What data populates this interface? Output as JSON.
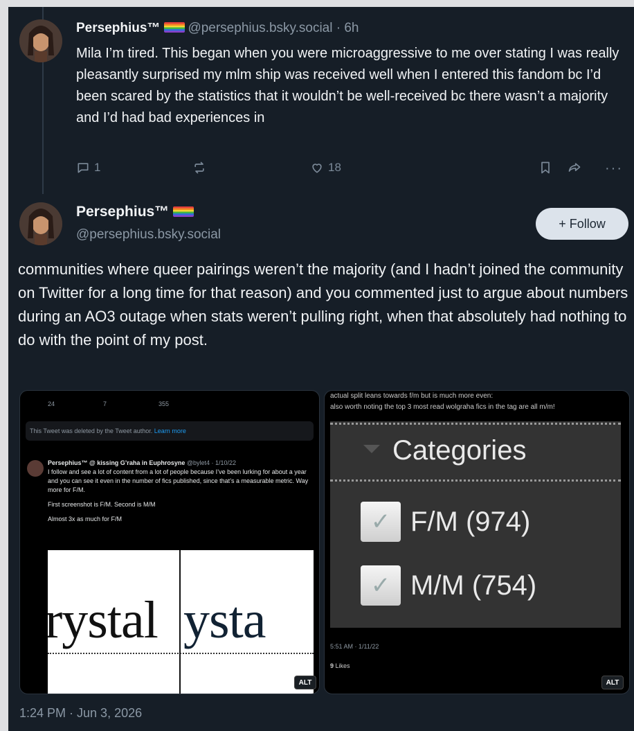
{
  "post1": {
    "name": "Persephius™",
    "handle": "@persephius.bsky.social",
    "time": "· 6h",
    "body": "Mila I’m tired. This began when you were microaggressive to me over stating I was really pleasantly surprised my mlm ship was received well when I entered this fandom bc I’d been scared by the statistics that it wouldn’t be well-received bc there wasn’t a majority and I’d had bad experiences in",
    "replies": "1",
    "likes": "18"
  },
  "post2": {
    "name": "Persephius™",
    "handle": "@persephius.bsky.social",
    "follow_label": "+ Follow",
    "body": "communities where queer pairings weren’t the majority (and I hadn’t joined the community on Twitter for a long time for that reason) and you commented just to argue about numbers during an AO3 outage when stats weren’t pulling right, when that absolutely had nothing to do with the point of my post.",
    "timestamp": "1:24 PM · Jun 3, 2026"
  },
  "image1": {
    "counts": [
      "24",
      "7",
      "355"
    ],
    "deleted_text": "This Tweet was deleted by the Tweet author.",
    "learn_more": "Learn more",
    "tweet_author": "Persephius™ @ kissing G’raha in Euphrosyne",
    "tweet_handle_date": "@bylet4 · 1/10/22",
    "tweet_text": "I follow and see a lot of content from a lot of people because I’ve been lurking for about a year and you can see it even in the number of fics published, since that’s a measurable metric. Way more for F/M.",
    "tweet_line2": "First screenshot is F/M. Second is M/M",
    "tweet_line3": "Almost 3x as much for F/M",
    "crop_left": "rystal",
    "crop_right": "ysta",
    "alt": "ALT"
  },
  "image2": {
    "top_line1": "actual split leans towards f/m but is much more even:",
    "top_line2": "also worth noting the top 3 most read wolgraha fics in the tag are all m/m!",
    "categories_title": "Categories",
    "item1": "F/M (974)",
    "item2": "M/M (754)",
    "meta_time": "5:51 AM · 1/11/22",
    "likes_count": "9",
    "likes_label": "Likes",
    "alt": "ALT"
  }
}
